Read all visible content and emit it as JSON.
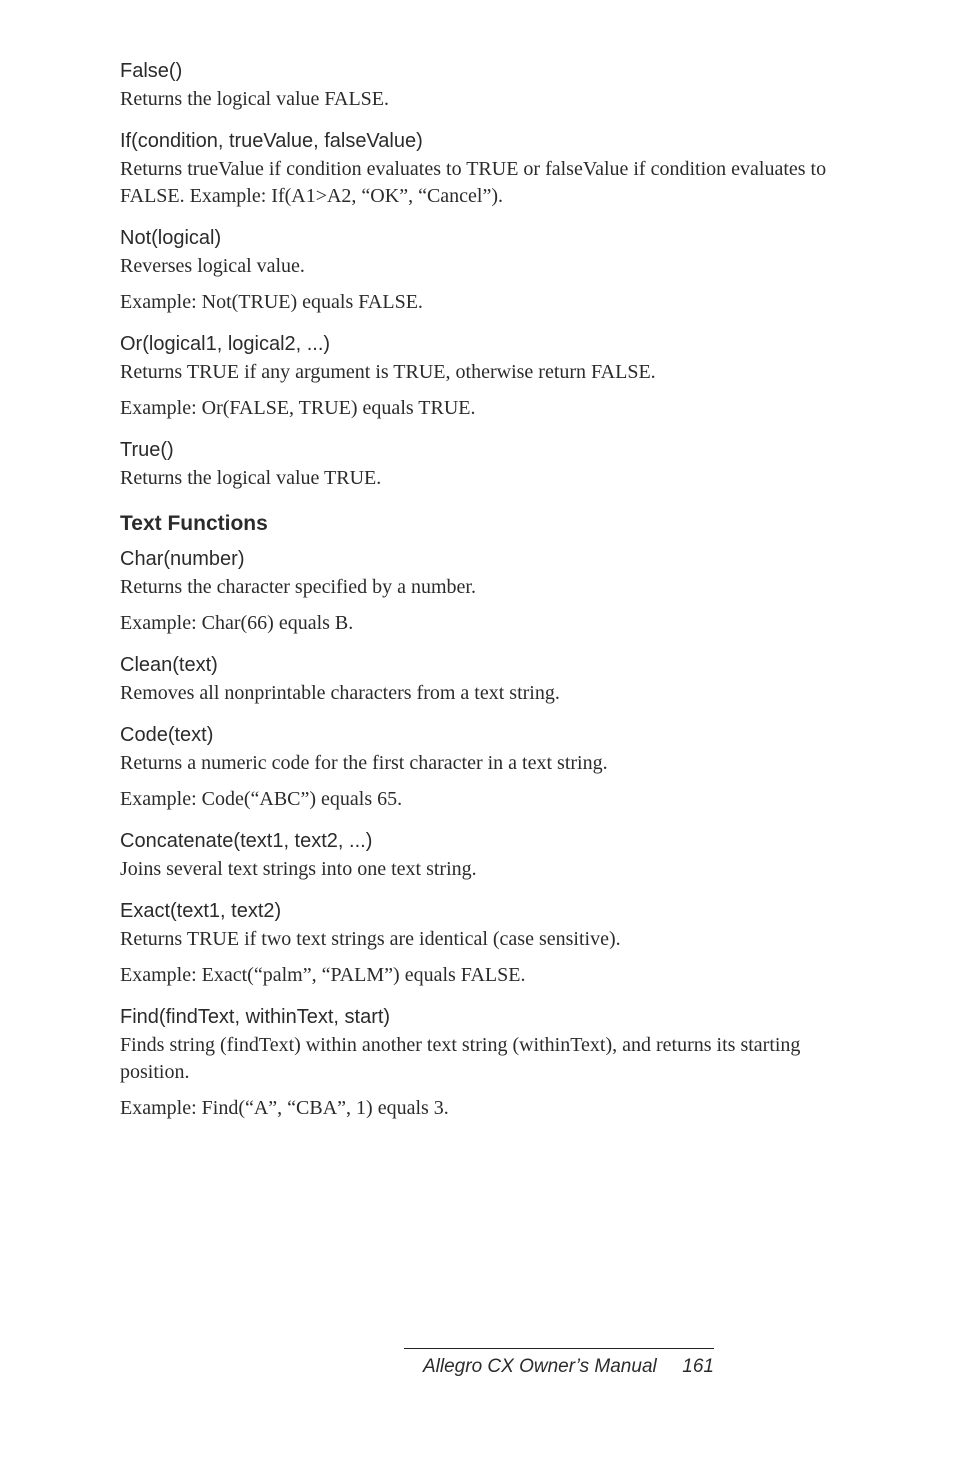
{
  "entries": [
    {
      "heading": "False()",
      "body": "Returns the logical value FALSE."
    },
    {
      "heading": "If(condition, trueValue, falseValue)",
      "body": "Returns trueValue if condition evaluates to TRUE or falseValue if condition evaluates to FALSE. Example: If(A1>A2, “OK”, “Cancel”)."
    },
    {
      "heading": "Not(logical)",
      "body": "Reverses logical value.",
      "example": "Example: Not(TRUE) equals FALSE."
    },
    {
      "heading": "Or(logical1, logical2, ...)",
      "body": "Returns TRUE if any argument is TRUE, otherwise return FALSE.",
      "example": "Example: Or(FALSE, TRUE) equals TRUE."
    },
    {
      "heading": "True()",
      "body": "Returns the logical value TRUE."
    }
  ],
  "section_heading": "Text Functions",
  "text_entries": [
    {
      "heading": "Char(number)",
      "body": "Returns the character specified by a number.",
      "example": "Example: Char(66) equals B."
    },
    {
      "heading": "Clean(text)",
      "body": "Removes all nonprintable characters from a text string."
    },
    {
      "heading": "Code(text)",
      "body": "Returns a numeric code for the first character in a text string.",
      "example": "Example: Code(“ABC”) equals 65."
    },
    {
      "heading": "Concatenate(text1, text2, ...)",
      "body": "Joins several text strings into one text string."
    },
    {
      "heading": "Exact(text1, text2)",
      "body": "Returns TRUE if two text strings are identical (case sensitive).",
      "example": "Example: Exact(“palm”, “PALM”) equals FALSE."
    },
    {
      "heading": "Find(findText, withinText, start)",
      "body": "Finds string (findText) within another text string (withinText), and returns its starting position.",
      "example": "Example: Find(“A”, “CBA”, 1) equals 3."
    }
  ],
  "footer": {
    "title": "Allegro CX Owner’s Manual",
    "page": "161"
  }
}
